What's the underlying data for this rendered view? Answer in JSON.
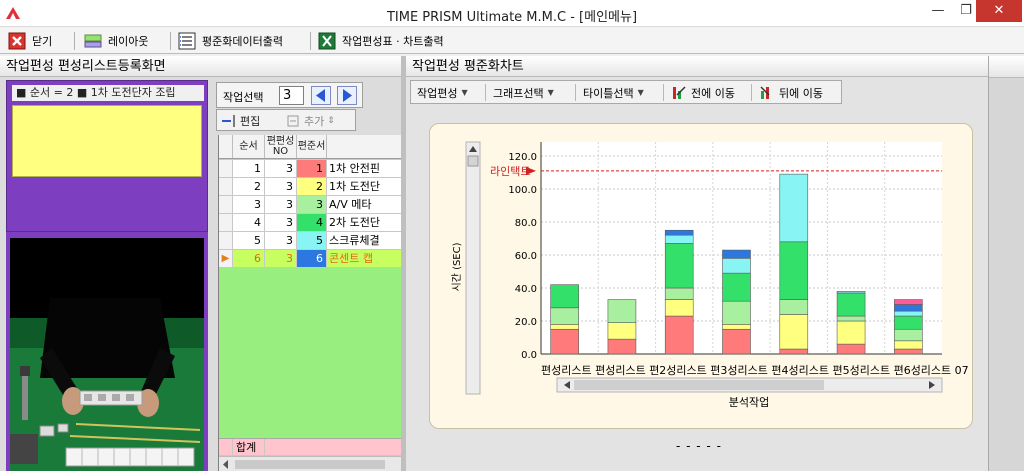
{
  "window": {
    "title": "TIME PRISM Ultimate M.M.C - [메인메뉴]",
    "min_glyph": "—",
    "max_glyph": "❐",
    "close_glyph": "✕"
  },
  "menubar": {
    "close_label": "닫기",
    "layout_label": "레이아웃",
    "standard_output_label": "평준화데이터출력",
    "chart_output_label": "작업편성표 · 차트출력"
  },
  "left": {
    "header": "작업편성 편성리스트등록화면",
    "step_label": "■ 순서 = 2 ■ 1차 도전단자 조립",
    "work_select_label": "작업선택",
    "work_select_value": "3",
    "edit_label": "편집",
    "add_label": "추가",
    "grid": {
      "headers": [
        "순서",
        "편편성NO",
        "편준서"
      ],
      "header_name": "",
      "rows": [
        {
          "order": "1",
          "no": "3",
          "seq": "1",
          "name": "1차 안전핀",
          "seq_color": "#ff7b7b",
          "current": false
        },
        {
          "order": "2",
          "no": "3",
          "seq": "2",
          "name": "1차 도전단",
          "seq_color": "#ffff80",
          "current": false
        },
        {
          "order": "3",
          "no": "3",
          "seq": "3",
          "name": "A/V 메타",
          "seq_color": "#a8f0a0",
          "current": false
        },
        {
          "order": "4",
          "no": "3",
          "seq": "4",
          "name": "2차 도전단",
          "seq_color": "#33e06a",
          "current": false
        },
        {
          "order": "5",
          "no": "3",
          "seq": "5",
          "name": "스크류체결",
          "seq_color": "#88f4f4",
          "current": false
        },
        {
          "order": "6",
          "no": "3",
          "seq": "6",
          "name": "콘센트 캡",
          "seq_color": "#2d78e0",
          "current": true
        }
      ],
      "sum_label": "합계"
    }
  },
  "right": {
    "header": "작업편성 평준화차트",
    "toolbar": {
      "work_label": "작업편성",
      "graph_label": "그래프선택",
      "title_label": "타이틀선택",
      "prev_label": "전에 이동",
      "next_label": "뒤에 이동"
    },
    "dashes": "- - - - -"
  },
  "chart_data": {
    "type": "bar",
    "stacked": true,
    "ylabel": "시간 (SEC)",
    "xlabel": "분석작업",
    "ylim": [
      0,
      120
    ],
    "yticks": [
      "0.0",
      "20.0",
      "40.0",
      "60.0",
      "80.0",
      "100.0",
      "120.0"
    ],
    "line_label": "라인택트",
    "line_value": 111,
    "grid": true,
    "categories": [
      "편성리스트",
      "편성리스트",
      "편성리스트",
      "편성리스트",
      "편성리스트",
      "편성리스트",
      "편성리스트"
    ],
    "xtick_text": "편성리스트 편성리스트 편2성리스트 편3성리스트 편4성리스트 편5성리스트 편6성리스트 07",
    "segment_colors": [
      "#ff7b7b",
      "#ffff80",
      "#a8f0a0",
      "#33e06a",
      "#88f4f4",
      "#2d78e0"
    ],
    "stacks": [
      [
        15,
        3,
        10,
        14,
        0,
        0
      ],
      [
        9,
        10,
        14,
        0,
        0,
        0
      ],
      [
        23,
        10,
        7,
        27,
        5,
        0
      ],
      [
        15,
        3,
        14,
        17,
        9,
        5
      ],
      [
        3,
        21,
        9,
        35,
        41,
        0
      ],
      [
        6,
        14,
        3,
        14,
        1,
        0
      ],
      [
        3,
        5,
        7,
        8,
        3,
        4
      ]
    ],
    "stack_extras": [
      {
        "index": 2,
        "extra_color": "#2d78e0",
        "extra_value": 3
      },
      {
        "index": 6,
        "extra_color": "#ff5a9a",
        "extra_value": 3
      }
    ]
  }
}
